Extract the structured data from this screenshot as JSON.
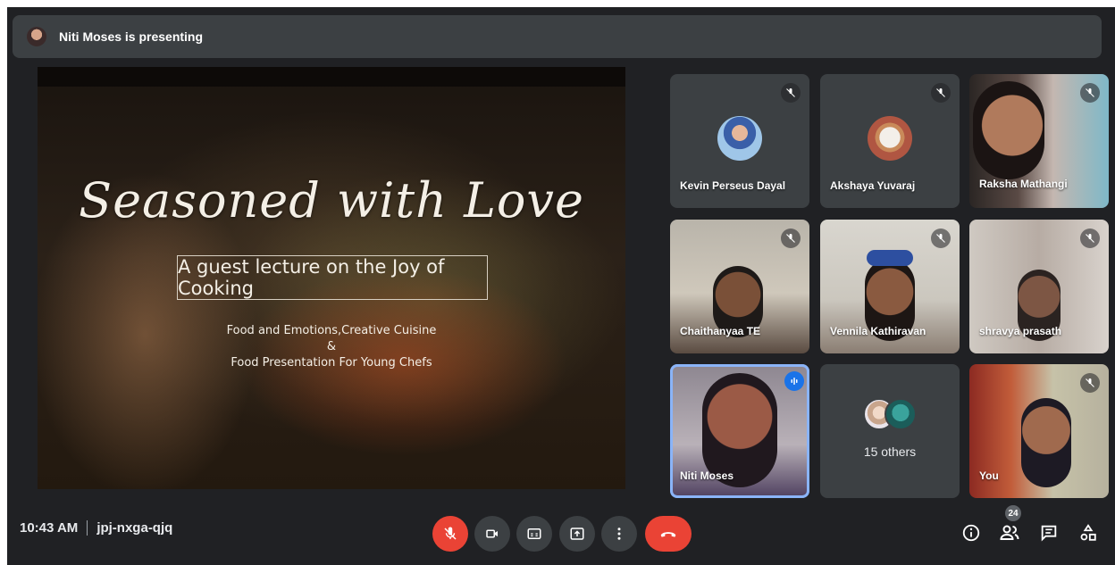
{
  "banner": {
    "text": "Niti Moses is presenting"
  },
  "slide": {
    "title": "Seasoned with Love",
    "subtitle": "A guest lecture on the Joy of Cooking",
    "line1": "Food and Emotions,Creative Cuisine",
    "line2": "&",
    "line3": "Food Presentation For Young Chefs"
  },
  "participants": [
    {
      "name": "Kevin Perseus Dayal",
      "muted": true
    },
    {
      "name": "Akshaya Yuvaraj",
      "muted": true
    },
    {
      "name": "Raksha Mathangi",
      "muted": true
    },
    {
      "name": "Chaithanyaa TE",
      "muted": true
    },
    {
      "name": "Vennila Kathiravan",
      "muted": true
    },
    {
      "name": "shravya prasath",
      "muted": true
    },
    {
      "name": "Niti Moses",
      "muted": false,
      "speaking": true
    },
    {
      "name": "15 others"
    },
    {
      "name": "You",
      "muted": true
    }
  ],
  "meeting": {
    "time": "10:43 AM",
    "code": "jpj-nxga-qjq"
  },
  "people_count": "24",
  "colors": {
    "background": "#202124",
    "tile": "#3c4043",
    "red": "#ea4335",
    "accent": "#8ab4f8"
  },
  "icons": [
    "mic-off-icon",
    "camera-icon",
    "captions-icon",
    "present-icon",
    "more-icon",
    "end-call-icon",
    "info-icon",
    "people-icon",
    "chat-icon",
    "activities-icon"
  ]
}
